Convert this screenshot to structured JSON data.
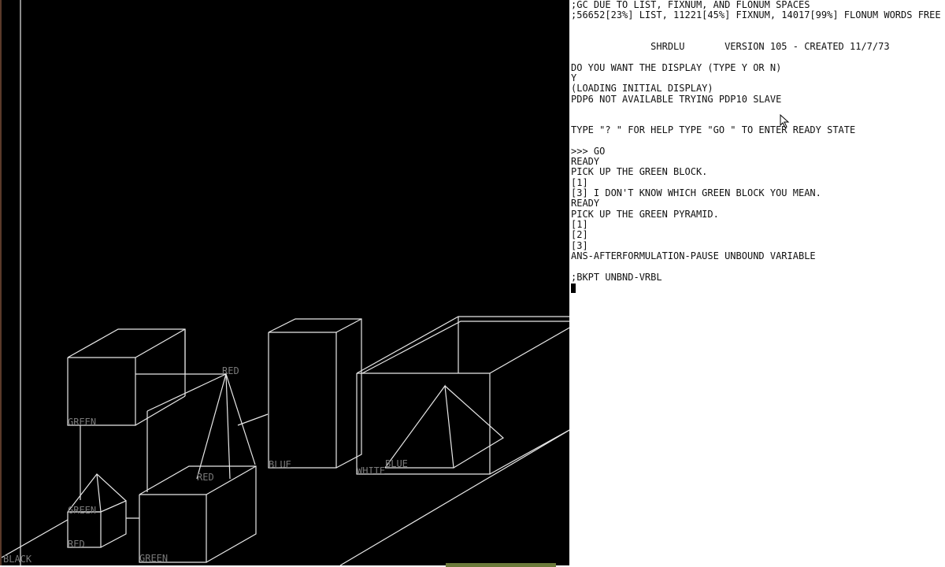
{
  "display": {
    "labels": [
      {
        "text": "GREEN"
      },
      {
        "text": "RED"
      },
      {
        "text": "BLUE"
      },
      {
        "text": "WHITE"
      },
      {
        "text": "BLUE"
      },
      {
        "text": "RED"
      },
      {
        "text": "GREEN"
      },
      {
        "text": "RED"
      },
      {
        "text": "GREEN"
      },
      {
        "text": "BLACK"
      }
    ]
  },
  "terminal": {
    "lines": [
      ";GC DUE TO LIST, FIXNUM, AND FLONUM SPACES",
      ";56652[23%] LIST, 11221[45%] FIXNUM, 14017[99%] FLONUM WORDS FREE",
      "",
      "",
      "              SHRDLU       VERSION 105 - CREATED 11/7/73",
      "",
      "DO YOU WANT THE DISPLAY (TYPE Y OR N)",
      "Y",
      "(LOADING INITIAL DISPLAY)",
      "PDP6 NOT AVAILABLE TRYING PDP10 SLAVE",
      "",
      "",
      "TYPE \"? \" FOR HELP TYPE \"GO \" TO ENTER READY STATE",
      "",
      ">>> GO",
      "READY",
      "PICK UP THE GREEN BLOCK.",
      "[1]",
      "[3] I DON'T KNOW WHICH GREEN BLOCK YOU MEAN.",
      "READY",
      "PICK UP THE GREEN PYRAMID.",
      "[1]",
      "[2]",
      "[3]",
      "ANS-AFTERFORMULATION-PAUSE UNBOUND VARIABLE",
      "",
      ";BKPT UNBND-VRBL"
    ]
  },
  "colors": {
    "display_background": "#000000",
    "wireframe": "#e8e8e8",
    "label": "#7a7a7a",
    "terminal_background": "#ffffff",
    "terminal_text": "#111111"
  },
  "icons": {
    "pointer": "mouse-pointer-icon",
    "cursor": "text-cursor"
  }
}
